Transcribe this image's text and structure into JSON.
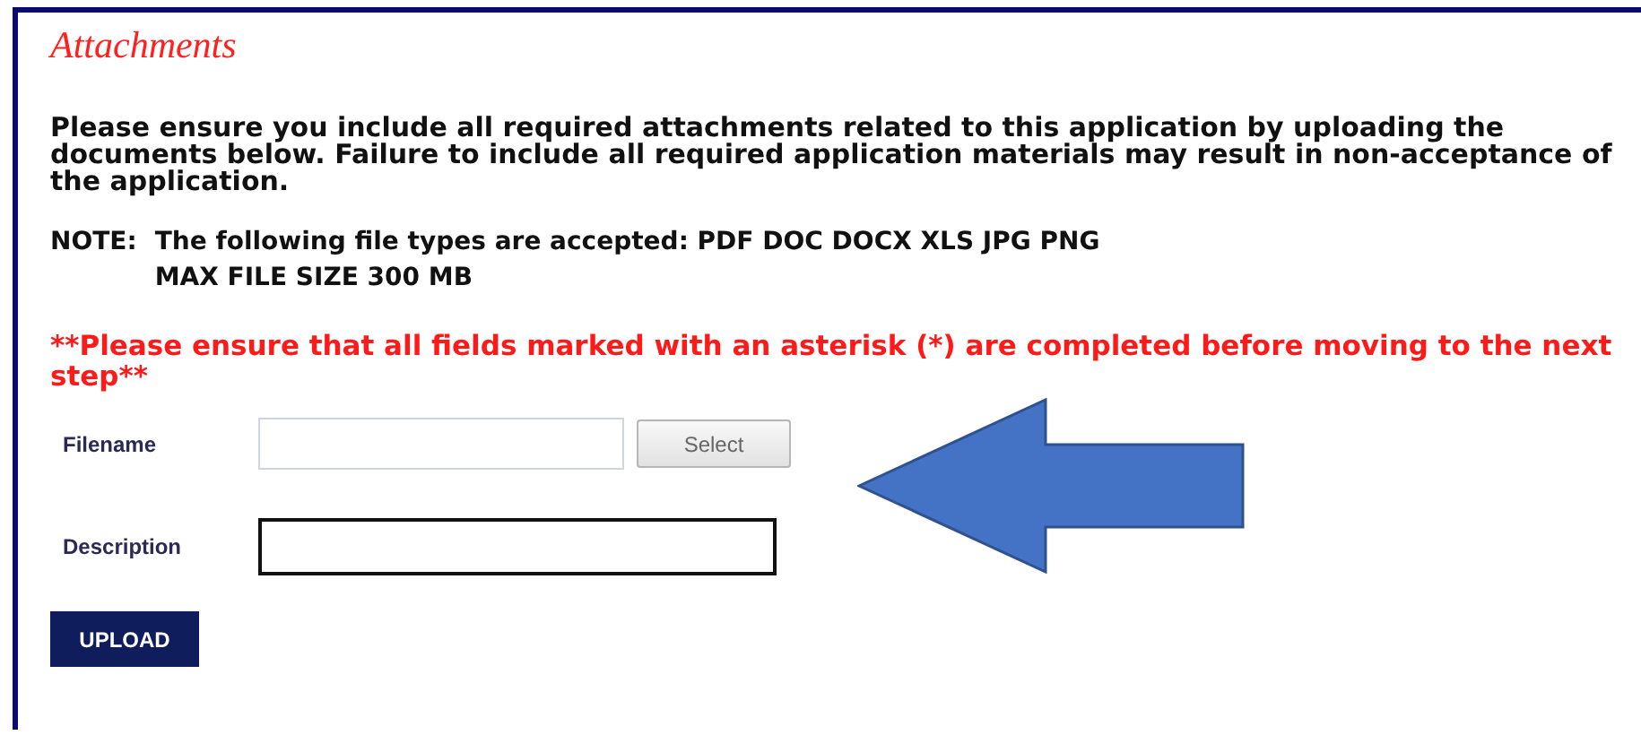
{
  "section": {
    "title": "Attachments"
  },
  "intro": "Please ensure you include all required attachments related to this application by uploading the documents below. Failure to include all required application materials may result in non-acceptance of the application.",
  "note": {
    "label": "NOTE:",
    "lines": [
      "The following file types are accepted: PDF DOC DOCX XLS JPG PNG",
      "MAX FILE SIZE 300 MB"
    ]
  },
  "warning": "**Please ensure that all fields marked with an asterisk (*) are completed before moving to the next step**",
  "fields": [
    {
      "kind": "file",
      "label": "Filename",
      "button": "Select"
    },
    {
      "kind": "text",
      "label": "Description"
    }
  ],
  "upload_button": "UPLOAD"
}
